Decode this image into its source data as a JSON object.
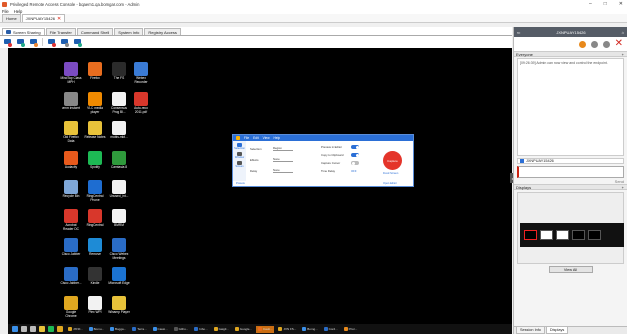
{
  "window": {
    "title": "Privileged Remote Access Console - bqaem1.qa.bomgar.com - Admin",
    "controls": [
      "–",
      "□",
      "✕"
    ]
  },
  "menu": {
    "items": [
      "File",
      "Help"
    ]
  },
  "session_tabs": [
    {
      "label": "Home"
    },
    {
      "label": "JXNPUAY15426",
      "close": "✕"
    }
  ],
  "tool_tabs": [
    "Screen Sharing",
    "File Transfer",
    "Command Shell",
    "System Info",
    "Registry Access"
  ],
  "desktop_icons": [
    {
      "label": "MindTap Class MPH",
      "color": "#7b4bc2"
    },
    {
      "label": "Firefox",
      "color": "#e86d1f"
    },
    {
      "label": "The FS",
      "color": "#2b2b2b"
    },
    {
      "label": "Webex Recorder",
      "color": "#3a7bd5"
    },
    {
      "label": "vmm instcert",
      "color": "#888888"
    },
    {
      "label": "VLC media player",
      "color": "#f08a00"
    },
    {
      "label": "Consensus Prog Bl...",
      "color": "#f2f2f2"
    },
    {
      "label": "Auto-reco 2011.pdf",
      "color": "#d8372b"
    },
    {
      "label": "Old Firefox Data",
      "color": "#e8c23a"
    },
    {
      "label": "Release Notes",
      "color": "#e8c23a"
    },
    {
      "label": "mobis-mkt...",
      "color": "#f2f2f2"
    },
    {
      "label": "Audacity",
      "color": "#e85a1c"
    },
    {
      "label": "Spotify",
      "color": "#1db954"
    },
    {
      "label": "Camtasia 8",
      "color": "#2f9a3c"
    },
    {
      "label": "Recycle Bin",
      "color": "#7fa7d8"
    },
    {
      "label": "RingCentral Phone",
      "color": "#1e6dd1"
    },
    {
      "label": "Unused_int...",
      "color": "#f2f2f2"
    },
    {
      "label": "Acrobat Reader DC",
      "color": "#d8372b"
    },
    {
      "label": "RingCentral",
      "color": "#d8372b"
    },
    {
      "label": "BMRM",
      "color": "#f2f2f2"
    },
    {
      "label": "Cisco Jabber",
      "color": "#2a6cc6"
    },
    {
      "label": "Remove",
      "color": "#1e8bd6"
    },
    {
      "label": "Cisco Webex Meetings",
      "color": "#2a6cc6"
    },
    {
      "label": "Cisco Jabber...",
      "color": "#2a6cc6"
    },
    {
      "label": "Kindle",
      "color": "#333333"
    },
    {
      "label": "Microsoft Edge",
      "color": "#1b73d2"
    },
    {
      "label": "Google Chrome",
      "color": "#e0a720"
    },
    {
      "label": "Plex WPI",
      "color": "#f2f2f2"
    },
    {
      "label": "Winamp Player",
      "color": "#e8c23a"
    }
  ],
  "snip": {
    "title_items": [
      "File",
      "Edit",
      "View",
      "Help"
    ],
    "modes": [
      "Selection",
      "Window",
      "Screen"
    ],
    "fields": [
      {
        "key": "Selection",
        "value": "Region"
      },
      {
        "key": "Effects",
        "value": "None"
      },
      {
        "key": "Delay",
        "value": "None"
      }
    ],
    "toggles": [
      {
        "key": "Preview in Editor",
        "on": true
      },
      {
        "key": "Copy to Clipboard",
        "on": true
      },
      {
        "key": "Capture Cursor",
        "on": false
      },
      {
        "key": "Time Delay",
        "value": "OFF"
      }
    ],
    "capture_label": "Capture",
    "fixed_label": "Fixed Screen",
    "presets_label": "Presets",
    "open_editor_label": "Open Editor"
  },
  "taskbar": {
    "apps": [
      "JXNF...",
      "Bomu...",
      "Bogga...",
      "Terra...",
      "Cassi...",
      "Githu...",
      "Inbo...",
      "Gaigil...",
      "Google...",
      "Cauti...",
      "JXN FS...",
      "Bomg...",
      "Cord...",
      "Prior..."
    ]
  },
  "side": {
    "session_name": "JXNPUAY15426",
    "everyone_label": "Everyone",
    "chat_message": "[09:26:39] Admin can now view and control the endpoint.",
    "user_label": "JXNPUAY15426",
    "send_label": "Send",
    "displays_label": "Displays",
    "view_all_label": "View All",
    "bottom_tabs": [
      "Session Info",
      "Displays"
    ]
  }
}
